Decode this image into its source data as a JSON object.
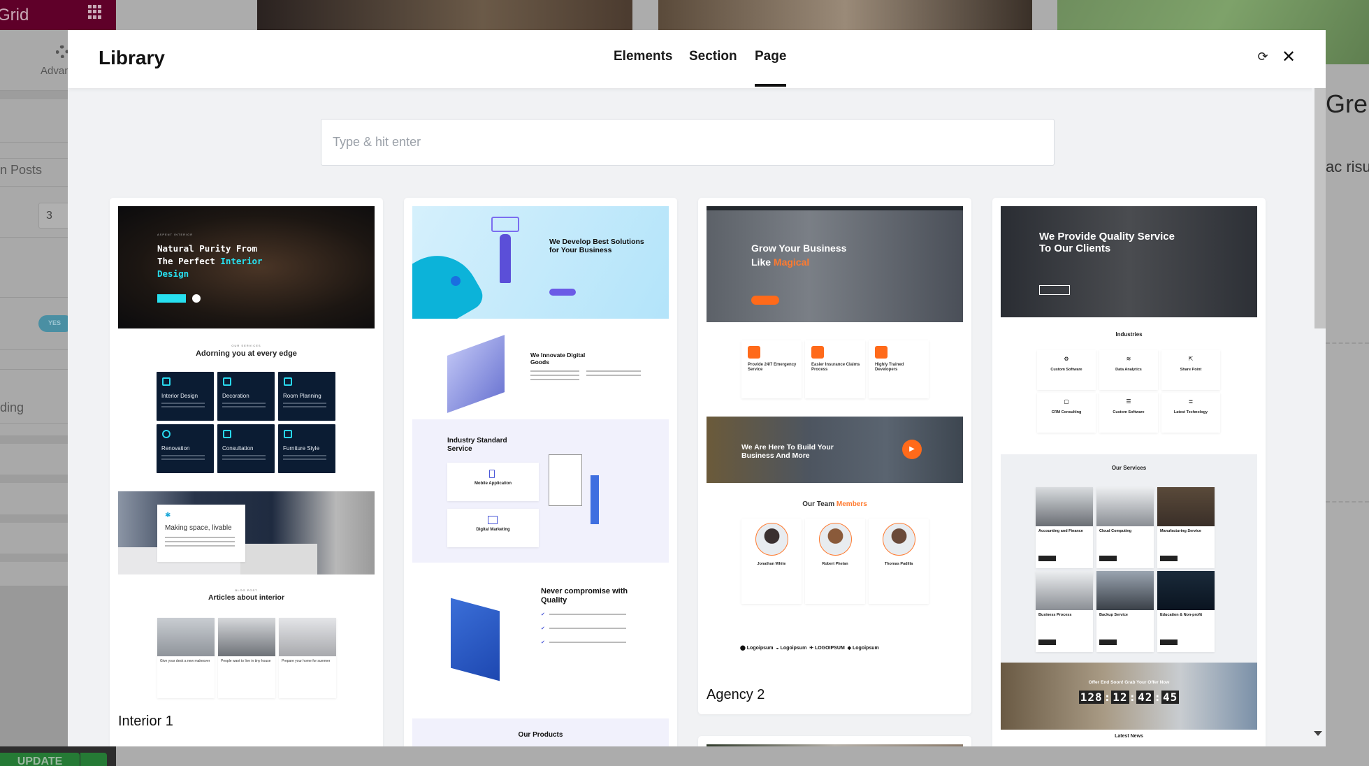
{
  "editor": {
    "title": "Grid",
    "advanced_label": "Advanced",
    "posts_label": "n Posts",
    "posts_value": "3",
    "toggle_label": "YES",
    "heading_label": "ding",
    "update_label": "UPDATE",
    "preview_heading": "Gre",
    "preview_text": "ac risus"
  },
  "modal": {
    "title": "Library",
    "tabs": [
      {
        "label": "Elements",
        "active": false
      },
      {
        "label": "Section",
        "active": false
      },
      {
        "label": "Page",
        "active": true
      }
    ],
    "search_placeholder": "Type & hit enter",
    "search_value": "",
    "icons": {
      "refresh": "refresh-icon",
      "close": "close-icon"
    }
  },
  "templates": [
    {
      "label": "Interior 1",
      "hero_kicker": "ASPENT INTERIOR",
      "hero_line1": "Natural Purity From",
      "hero_line2": "The Perfect ",
      "hero_accent2": "Interior",
      "hero_accent3": "Design",
      "services_kicker": "OUR SERVICES",
      "services_title": "Adorning you at every edge",
      "services": [
        "Interior Design",
        "Decoration",
        "Room Planning",
        "Renovation",
        "Consultation",
        "Furniture Style"
      ],
      "banner_title": "Making space, livable",
      "blog_kicker": "BLOG POST",
      "blog_title": "Articles about interior",
      "posts": [
        "Give your desk a new makeover",
        "People want to live in tiny house",
        "Prepare your home for summer"
      ],
      "accent": "#27e0f0"
    },
    {
      "label": "",
      "hero_title": "We Develop Best Solutions for Your Business",
      "innovate_title": "We Innovate Digital Goods",
      "industry_title": "Industry Standard Service",
      "industry_items": [
        "Mobile Application",
        "Digital Marketing"
      ],
      "quality_title": "Never compromise with Quality",
      "products_title": "Our Products",
      "accent": "#6b5be6"
    },
    {
      "label": "Agency 2",
      "hero_line1": "Grow Your Business",
      "hero_line2": "Like ",
      "hero_accent": "Magical",
      "features": [
        "Provide 24/7 Emergency Service",
        "Easier Insurance Claims Process",
        "Highly Trained Developers"
      ],
      "video_title": "We Are Here To Build Your Business And More",
      "team_title": "Our Team ",
      "team_accent": "Members",
      "team": [
        {
          "name": "Jonathan White"
        },
        {
          "name": "Robert Phelan"
        },
        {
          "name": "Thomas Padilla"
        }
      ],
      "logos": [
        "Logoipsum",
        "Logoipsum",
        "LOGOIPSUM",
        "Logoipsum"
      ],
      "accent": "#ff7a2f"
    },
    {
      "label": "",
      "hero_title": "We Provide Quality Service To Our Clients",
      "industries_title": "Industries",
      "industries": [
        "Custom Software",
        "Data Analytics",
        "Share Point",
        "CRM Consulting",
        "Custom Software",
        "Latest Technology"
      ],
      "services_title": "Our Services",
      "services": [
        "Accounting and Finance",
        "Cloud Computing",
        "Manufacturing Service",
        "Business Process",
        "Backup Service",
        "Education & Non-profit"
      ],
      "offer_title": "Offer End Soon! Grab Your Offer Now",
      "countdown": [
        "128",
        "12",
        "42",
        "45"
      ],
      "news_title": "Latest News"
    }
  ]
}
